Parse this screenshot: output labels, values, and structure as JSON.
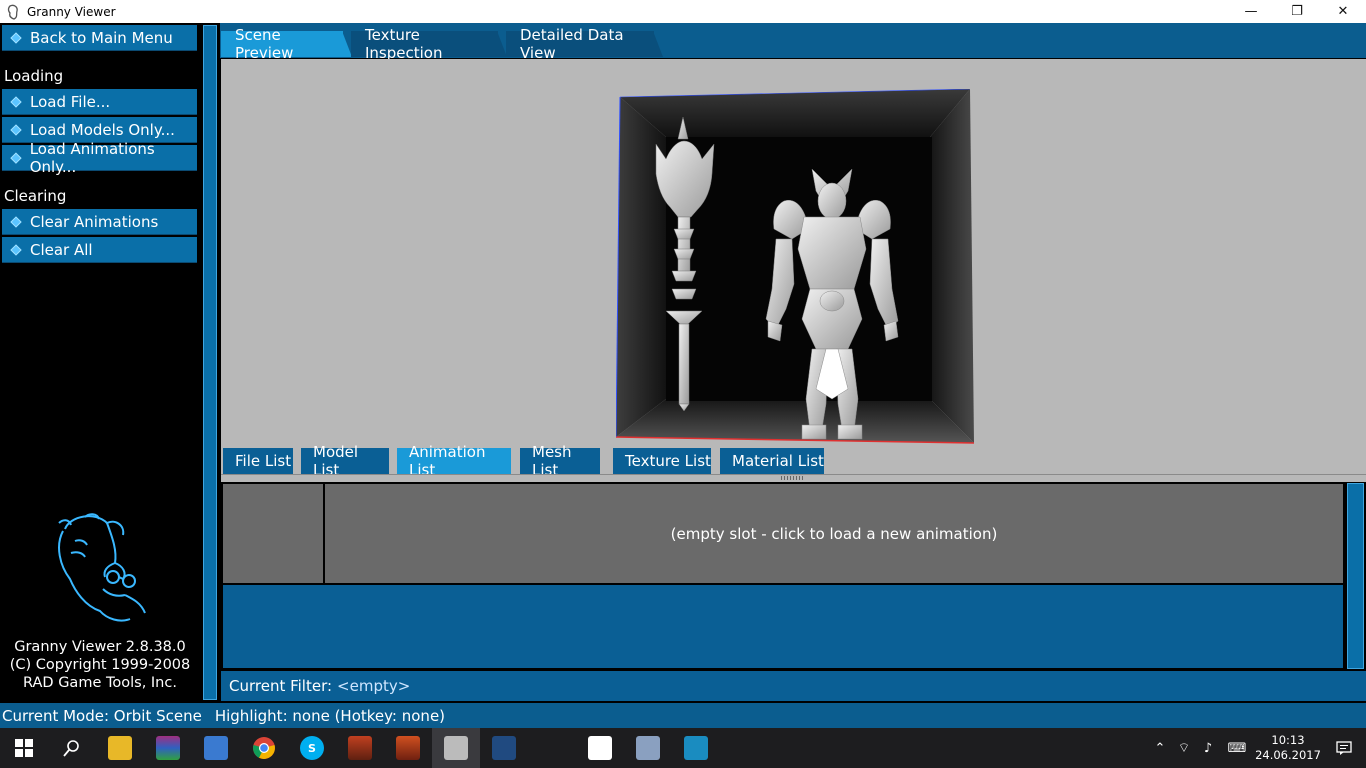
{
  "window": {
    "title": "Granny Viewer",
    "minimize_glyph": "—",
    "restore_glyph": "❐",
    "close_glyph": "✕"
  },
  "sidebar": {
    "back_label": "Back to Main Menu",
    "loading_heading": "Loading",
    "load_file_label": "Load File...",
    "load_models_label": "Load Models Only...",
    "load_animations_label": "Load Animations Only...",
    "clearing_heading": "Clearing",
    "clear_animations_label": "Clear Animations",
    "clear_all_label": "Clear All",
    "about_line1": "Granny Viewer 2.8.38.0",
    "about_line2": "(C) Copyright 1999-2008",
    "about_line3": "RAD Game Tools, Inc."
  },
  "top_tabs": [
    {
      "label": "Scene Preview",
      "active": true
    },
    {
      "label": "Texture Inspection",
      "active": false
    },
    {
      "label": "Detailed Data View",
      "active": false
    }
  ],
  "bottom_tabs": [
    {
      "label": "File List",
      "active": false
    },
    {
      "label": "Model List",
      "active": false
    },
    {
      "label": "Animation List",
      "active": true
    },
    {
      "label": "Mesh List",
      "active": false
    },
    {
      "label": "Texture List",
      "active": false
    },
    {
      "label": "Material List",
      "active": false
    }
  ],
  "animation_panel": {
    "empty_slot_text": "(empty slot - click to load a new animation)"
  },
  "filter": {
    "label": "Current Filter:",
    "value": "<empty>"
  },
  "status": {
    "mode": "Current Mode: Orbit Scene",
    "highlight": "Highlight: none (Hotkey: none)"
  },
  "taskbar": {
    "time": "10:13",
    "date": "24.06.2017"
  },
  "colors": {
    "accent": "#0a6fa8",
    "active_tab": "#1a9ad8",
    "viewport_bg": "#b8b8b8"
  }
}
